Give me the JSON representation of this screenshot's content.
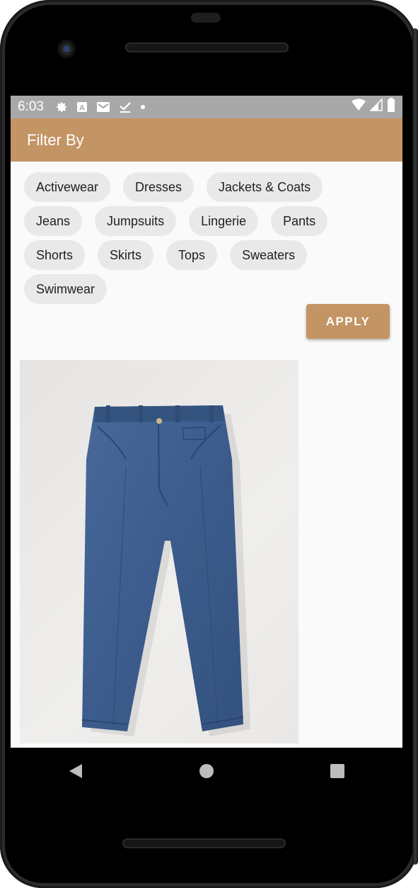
{
  "status_bar": {
    "time": "6:03",
    "icons": [
      "gear-icon",
      "a-icon",
      "mail-icon",
      "check-download-icon",
      "dot-icon"
    ],
    "right_icons": [
      "wifi-icon",
      "signal-icon",
      "battery-icon"
    ]
  },
  "app_bar": {
    "title": "Filter By"
  },
  "filter_chips": [
    "Activewear",
    "Dresses",
    "Jackets & Coats",
    "Jeans",
    "Jumpsuits",
    "Lingerie",
    "Pants",
    "Shorts",
    "Skirts",
    "Tops",
    "Sweaters",
    "Swimwear"
  ],
  "apply_button": {
    "label": "APPLY"
  },
  "product": {
    "image": "jeans-photo"
  },
  "nav_bar": {
    "buttons": [
      "back-icon",
      "home-icon",
      "recents-icon"
    ]
  },
  "colors": {
    "accent": "#c39464",
    "status_bar": "#a8a8a8",
    "chip_bg": "#e9e9e9",
    "denim": "#3d5f8f"
  }
}
